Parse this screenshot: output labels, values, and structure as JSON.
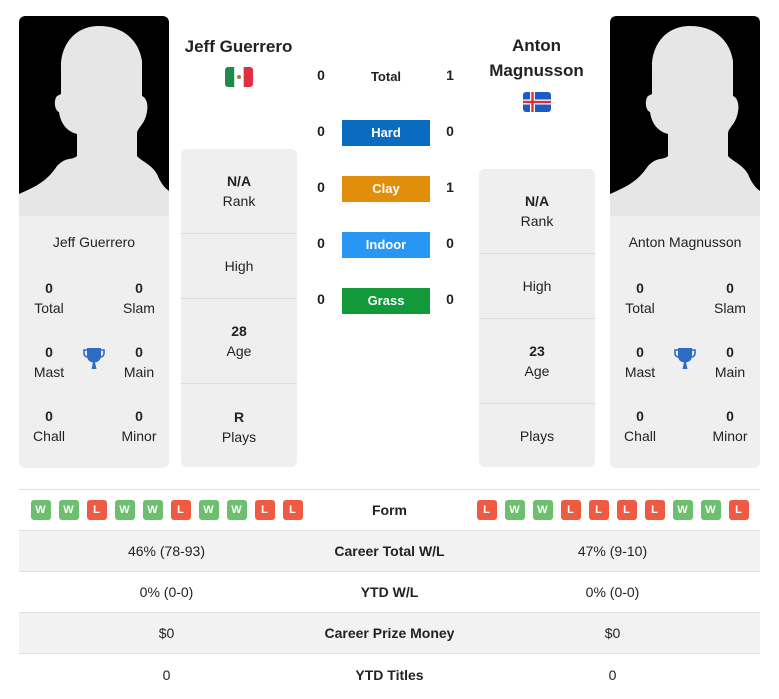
{
  "players": [
    {
      "name": "Jeff Guerrero",
      "title_lines": [
        "Jeff Guerrero"
      ],
      "flag": "mexico-flag",
      "titles": {
        "total": "0",
        "slam": "0",
        "mast": "0",
        "main": "0",
        "chall": "0",
        "minor": "0"
      },
      "rank": "N/A",
      "high": "",
      "age": "28",
      "plays": "R",
      "form": [
        "W",
        "W",
        "L",
        "W",
        "W",
        "L",
        "W",
        "W",
        "L",
        "L"
      ]
    },
    {
      "name": "Anton Magnusson",
      "title_lines": [
        "Anton",
        "Magnusson"
      ],
      "flag": "iceland-flag",
      "titles": {
        "total": "0",
        "slam": "0",
        "mast": "0",
        "main": "0",
        "chall": "0",
        "minor": "0"
      },
      "rank": "N/A",
      "high": "",
      "age": "23",
      "plays": "",
      "form": [
        "L",
        "W",
        "W",
        "L",
        "L",
        "L",
        "L",
        "W",
        "W",
        "L"
      ]
    }
  ],
  "labels": {
    "total": "Total",
    "slam": "Slam",
    "mast": "Mast",
    "main": "Main",
    "chall": "Chall",
    "minor": "Minor",
    "rank": "Rank",
    "high": "High",
    "age": "Age",
    "plays": "Plays"
  },
  "h2h": {
    "total": {
      "label": "Total",
      "p1": "0",
      "p2": "1"
    },
    "surfaces": [
      {
        "label": "Hard",
        "p1": "0",
        "p2": "0",
        "color": "#0a6cc0"
      },
      {
        "label": "Clay",
        "p1": "0",
        "p2": "1",
        "color": "#e08e0b"
      },
      {
        "label": "Indoor",
        "p1": "0",
        "p2": "0",
        "color": "#2896f3"
      },
      {
        "label": "Grass",
        "p1": "0",
        "p2": "0",
        "color": "#12993a"
      }
    ]
  },
  "stats": [
    {
      "label": "Form"
    },
    {
      "label": "Career Total W/L",
      "p1": "46% (78-93)",
      "p2": "47% (9-10)"
    },
    {
      "label": "YTD W/L",
      "p1": "0% (0-0)",
      "p2": "0% (0-0)"
    },
    {
      "label": "Career Prize Money",
      "p1": "$0",
      "p2": "$0"
    },
    {
      "label": "YTD Titles",
      "p1": "0",
      "p2": "0"
    }
  ]
}
